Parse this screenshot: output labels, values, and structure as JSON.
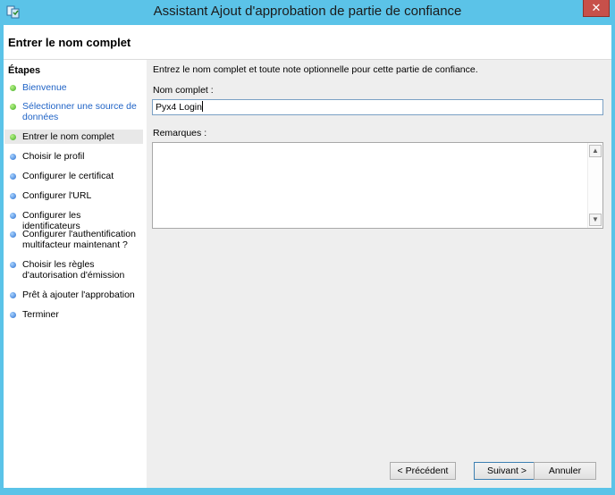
{
  "window": {
    "title": "Assistant Ajout d'approbation de partie de confiance",
    "close_glyph": "✕",
    "icon": "trust-wizard-icon"
  },
  "header": {
    "title": "Entrer le nom complet"
  },
  "sidebar": {
    "heading": "Étapes",
    "steps": [
      {
        "label": "Bienvenue",
        "status": "done"
      },
      {
        "label": "Sélectionner une source de données",
        "status": "done"
      },
      {
        "label": "Entrer le nom complet",
        "status": "current"
      },
      {
        "label": "Choisir le profil",
        "status": "pending"
      },
      {
        "label": "Configurer le certificat",
        "status": "pending"
      },
      {
        "label": "Configurer l'URL",
        "status": "pending"
      },
      {
        "label": "Configurer les identificateurs",
        "status": "pending"
      },
      {
        "label": "Configurer l'authentification multifacteur maintenant ?",
        "status": "pending"
      },
      {
        "label": "Choisir les règles d'autorisation d'émission",
        "status": "pending"
      },
      {
        "label": "Prêt à ajouter l'approbation",
        "status": "pending"
      },
      {
        "label": "Terminer",
        "status": "pending"
      }
    ]
  },
  "main": {
    "intro": "Entrez le nom complet et toute note optionnelle pour cette partie de confiance.",
    "name_label": "Nom complet :",
    "name_value": "Pyx4 Login",
    "remarks_label": "Remarques :",
    "remarks_value": ""
  },
  "buttons": {
    "previous": "< Précédent",
    "next": "Suivant >",
    "cancel": "Annuler"
  },
  "colors": {
    "title_bar": "#5bc3e8",
    "done_step_link": "#1f63c6",
    "done_dot": "#3fae20",
    "pending_dot": "#2a6fd0",
    "close_button": "#c7504a"
  }
}
